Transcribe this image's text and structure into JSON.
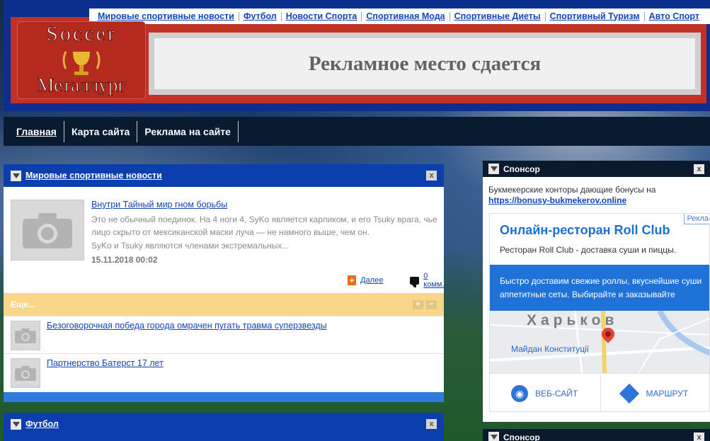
{
  "top_nav": {
    "links": [
      "Мировые спортивные новости",
      "Футбол",
      "Новости Спорта",
      "Спортивная Мода",
      "Спортивные Диеты",
      "Спортивный Туризм",
      "Авто Спорт"
    ]
  },
  "logo": {
    "line1": "Soccer",
    "line2": "Металлург"
  },
  "banner": {
    "text": "Рекламное место сдается"
  },
  "main_nav": {
    "links": [
      "Главная",
      "Карта сайта",
      "Реклама на сайте"
    ]
  },
  "news_panel": {
    "title": "Мировые спортивные новости",
    "close": "x",
    "article": {
      "title": "Внутри Тайный мир гном борьбы",
      "text": "Это не обычный поединок. На 4 ноги 4, SyKo является карликом, и его Tsuky врага, чье лицо скрыто от мексиканской маски луча — не намного выше, чем он.",
      "text2": "SyKo и Tsuky являются членами экстремальных...",
      "date": "15.11.2018 00:02",
      "more": "Далее",
      "comments": "0 комм.",
      "plus": "+"
    },
    "more_section": {
      "label": "Еще...",
      "buttons": [
        "+",
        "−"
      ],
      "items": [
        "Безоговорочная победа города омрачен пугать травма суперзвезды",
        "Партнерство Батерст 17 лет"
      ]
    }
  },
  "football_panel": {
    "title": "Футбол",
    "close": "x"
  },
  "sponsor": {
    "title": "Спонсор",
    "close": "x",
    "text": "Букмекерские конторы дающие бонусы на",
    "link": "https://bonusy-bukmekerov.online",
    "ad": {
      "badge": "Рекла",
      "title": "Онлайн-ресторан Roll Club",
      "subtitle": "Ресторан Roll Club - доставка суши и пиццы.",
      "blue_text1": "Быстро доставим свежие роллы, вкуснейшие суши",
      "blue_text2": "аппетитные сеты. Выбирайте и заказывайте",
      "map_city": "Харьков",
      "map_place": "Майдан Конституції",
      "website": "ВЕБ-САЙТ",
      "route": "МАРШРУТ"
    }
  },
  "sponsor2": {
    "title": "Спонсор",
    "close": "x"
  },
  "colors": {
    "header_blue": "#0b2f8c",
    "header_red": "#c23028",
    "panel_blue": "#0b3fae",
    "link": "#1546b4",
    "accent_orange": "#ef6c1a"
  }
}
